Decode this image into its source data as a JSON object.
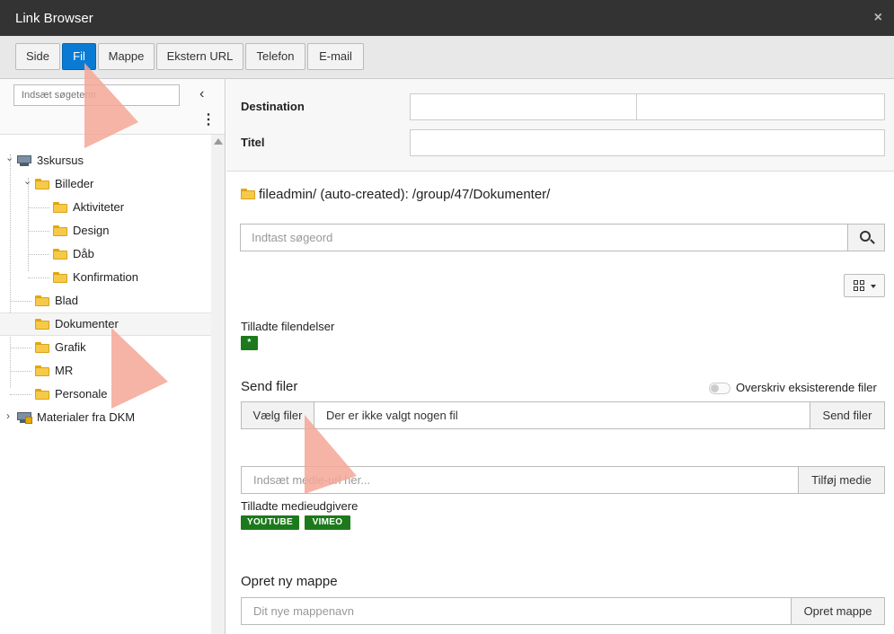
{
  "window": {
    "title": "Link Browser",
    "close_glyph": "×"
  },
  "tabs": [
    {
      "label": "Side",
      "active": false
    },
    {
      "label": "Fil",
      "active": true
    },
    {
      "label": "Mappe",
      "active": false
    },
    {
      "label": "Ekstern URL",
      "active": false
    },
    {
      "label": "Telefon",
      "active": false
    },
    {
      "label": "E-mail",
      "active": false
    }
  ],
  "sidebar": {
    "search_placeholder": "Indsæt søgeterm",
    "collapse_glyph": "‹",
    "menu_glyph": "⋮",
    "tree": [
      {
        "label": "3skursus",
        "icon": "mount-icon",
        "expanded": true
      },
      {
        "label": "Billeder",
        "icon": "folder-icon",
        "expanded": true
      },
      {
        "label": "Aktiviteter",
        "icon": "folder-icon"
      },
      {
        "label": "Design",
        "icon": "folder-icon"
      },
      {
        "label": "Dåb",
        "icon": "folder-icon"
      },
      {
        "label": "Konfirmation",
        "icon": "folder-icon"
      },
      {
        "label": "Blad",
        "icon": "folder-icon"
      },
      {
        "label": "Dokumenter",
        "icon": "folder-icon",
        "selected": true
      },
      {
        "label": "Grafik",
        "icon": "folder-icon"
      },
      {
        "label": "MR",
        "icon": "folder-icon"
      },
      {
        "label": "Personale",
        "icon": "folder-icon"
      },
      {
        "label": "Materialer fra DKM",
        "icon": "mount-locked-icon",
        "expanded": false
      }
    ]
  },
  "destination": {
    "destination_label": "Destination",
    "title_label": "Titel",
    "destination_value": "",
    "select_value": "",
    "title_value": ""
  },
  "main": {
    "current_path": "fileadmin/ (auto-created): /group/47/Dokumenter/",
    "search_placeholder": "Indtast søgeord",
    "allowed_ext_label": "Tilladte filendelser",
    "allowed_ext_badge": "*",
    "upload_title": "Send filer",
    "overwrite_label": "Overskriv eksisterende filer",
    "choose_files_label": "Vælg filer",
    "no_file_text": "Der er ikke valgt nogen fil",
    "send_files_button": "Send filer",
    "media_placeholder": "Indsæt medie-url her...",
    "add_media_button": "Tilføj medie",
    "media_providers_label": "Tilladte medieudgivere",
    "providers": [
      "YOUTUBE",
      "VIMEO"
    ],
    "new_folder_title": "Opret ny mappe",
    "new_folder_placeholder": "Dit nye mappenavn",
    "create_folder_button": "Opret mappe"
  },
  "colors": {
    "titlebar": "#333333",
    "active_tab": "#0a7bd4",
    "badge_green": "#1c7a1c",
    "folder_yellow": "#f7c948",
    "pointer_overlay": "#f4a796"
  }
}
